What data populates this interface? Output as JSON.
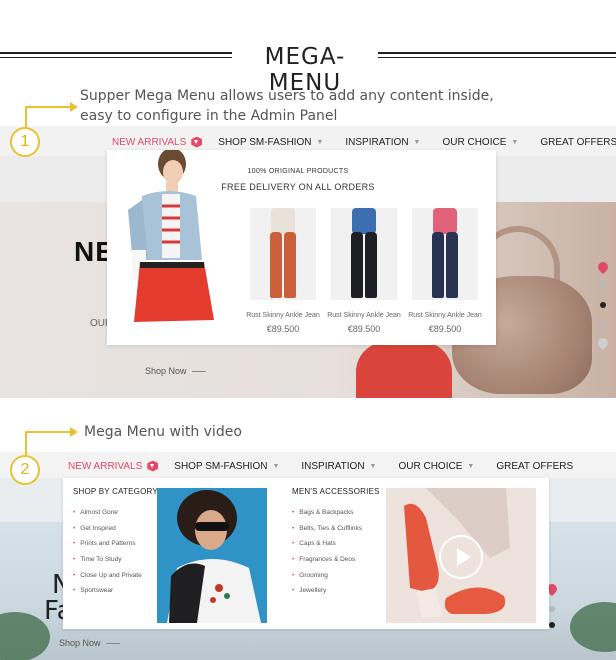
{
  "header": {
    "title": "MEGA-MENU"
  },
  "callout1": {
    "number": "1",
    "line1": "Supper Mega Menu allows users to add any content inside,",
    "line2": "easy to configure in the Admin Panel"
  },
  "callout2": {
    "number": "2",
    "text": "Mega Menu with video"
  },
  "nav_items": [
    {
      "label": "NEW ARRIVALS"
    },
    {
      "label": "SHOP SM-FASHION"
    },
    {
      "label": "INSPIRATION"
    },
    {
      "label": "OUR CHOICE"
    },
    {
      "label": "GREAT OFFERS"
    }
  ],
  "screen1": {
    "hero_title": "NE",
    "hero_sub": "OUR",
    "shop_now": "Shop Now",
    "promo_line1": "100% ORIGINAL PRODUCTS",
    "promo_line2": "FREE DELIVERY ON ALL ORDERS",
    "products": [
      {
        "name": "Rust Skinny Ankle Jean",
        "price": "€89.500",
        "pants_color": "#c9603a",
        "top_color": "#e9e2d8"
      },
      {
        "name": "Rust Skinny Ankle Jean",
        "price": "€89.500",
        "pants_color": "#1d1f24",
        "top_color": "#3b6fb0"
      },
      {
        "name": "Rust Skinny Ankle Jean",
        "price": "€89.500",
        "pants_color": "#283352",
        "top_color": "#e2627a"
      }
    ]
  },
  "screen2": {
    "hero_letter1": "N",
    "hero_letter2": "Fa",
    "shop_now": "Shop Now",
    "col1_heading": "SHOP BY CATEGORY",
    "col1_items": [
      "Almost Gone",
      "Get Inspired",
      "Prints and Patterns",
      "Time To Study",
      "Close Up and Private",
      "Sportswear"
    ],
    "col2_heading": "MEN'S ACCESSORIES",
    "col2_items": [
      "Bags & Backpacks",
      "Belts, Ties & Cufflinks",
      "Caps & Hats",
      "Fragrances & Deos",
      "Grooming",
      "Jewellery"
    ]
  },
  "colors": {
    "accent": "#e04a6a",
    "callout": "#e8c232"
  }
}
